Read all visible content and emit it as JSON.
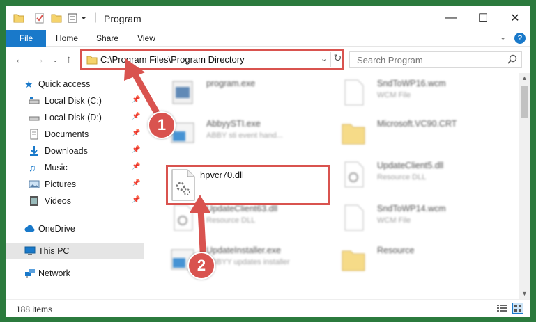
{
  "window": {
    "title": "Program"
  },
  "ribbon": {
    "tabs": [
      "File",
      "Home",
      "Share",
      "View"
    ]
  },
  "address": {
    "path": "C:\\Program Files\\Program Directory"
  },
  "search": {
    "placeholder": "Search Program"
  },
  "sidebar": {
    "items": [
      {
        "label": "Quick access"
      },
      {
        "label": "Local Disk (C:)"
      },
      {
        "label": "Local Disk (D:)"
      },
      {
        "label": "Documents"
      },
      {
        "label": "Downloads"
      },
      {
        "label": "Music"
      },
      {
        "label": "Pictures"
      },
      {
        "label": "Videos"
      },
      {
        "label": "OneDrive"
      },
      {
        "label": "This PC"
      },
      {
        "label": "Network"
      }
    ]
  },
  "files": [
    {
      "name": "program.exe",
      "sub": ""
    },
    {
      "name": "SndToWP16.wcm",
      "sub": "WCM File"
    },
    {
      "name": "AbbyySTI.exe",
      "sub": "ABBY sti event hand..."
    },
    {
      "name": "Microsoft.VC90.CRT",
      "sub": ""
    },
    {
      "name": "hpvcr70.dll",
      "sub": ""
    },
    {
      "name": "UpdateClient5.dll",
      "sub": "Resource DLL"
    },
    {
      "name": "UpdateClient63.dll",
      "sub": "Resource DLL"
    },
    {
      "name": "SndToWP14.wcm",
      "sub": "WCM File"
    },
    {
      "name": "UpdateInstaller.exe",
      "sub": "ABBYY updates installer"
    },
    {
      "name": "Resource",
      "sub": ""
    }
  ],
  "status": {
    "items": "188 items"
  },
  "annotations": {
    "step1": "1",
    "step2": "2"
  },
  "colors": {
    "accent": "#1979ca",
    "highlight": "#d9534f"
  }
}
